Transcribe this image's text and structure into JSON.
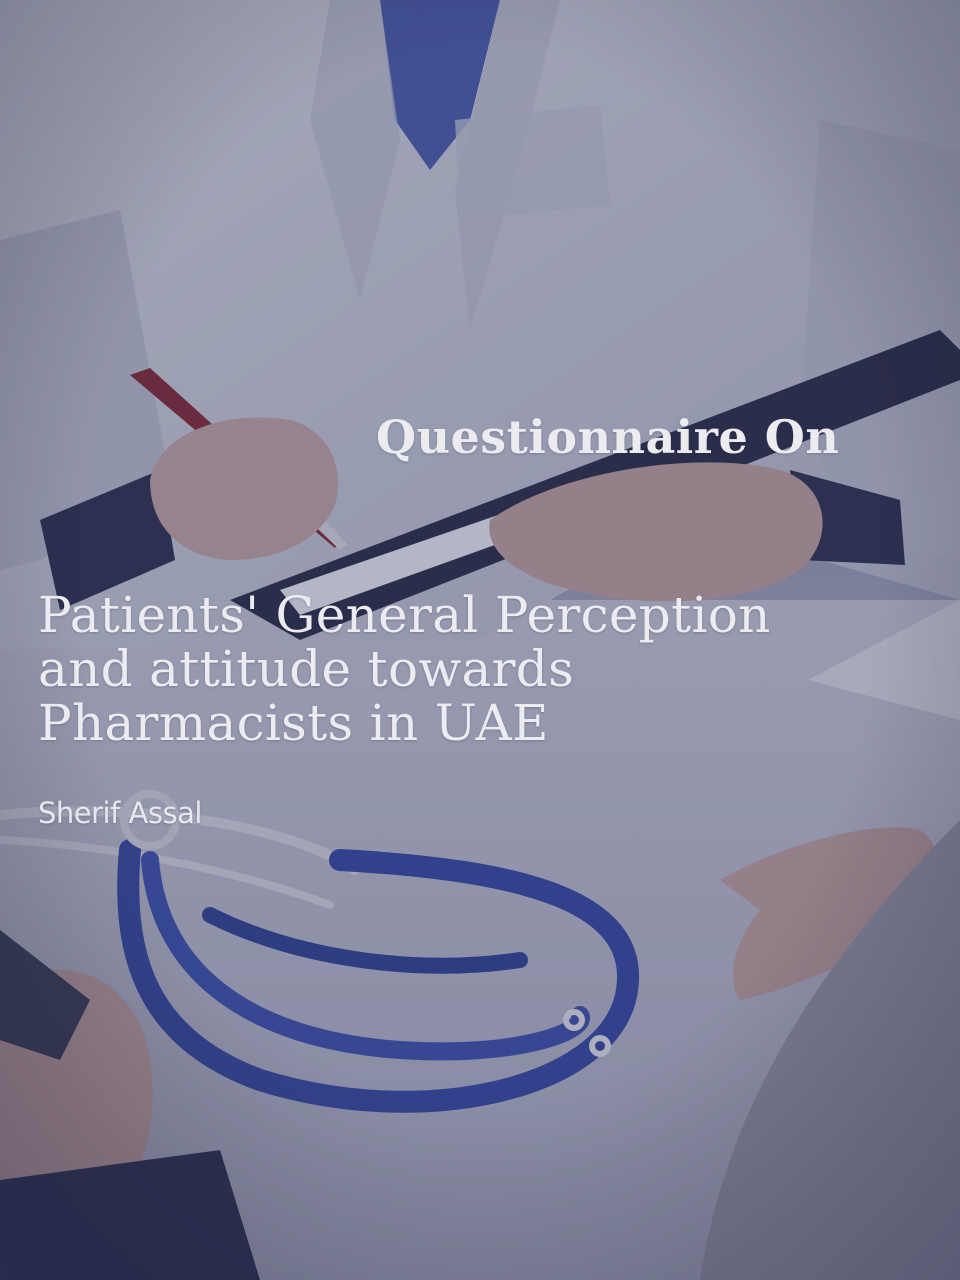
{
  "cover": {
    "heading": "Questionnaire On",
    "title_lines": [
      "Patients' General Perception",
      "and attitude towards",
      "Pharmacists in UAE"
    ],
    "author": "Sherif Assal"
  },
  "colors": {
    "overlay": "#2d3055",
    "text": "#ebebf0",
    "stethoscope": "#34469a",
    "coat": "#c9ccd8"
  }
}
